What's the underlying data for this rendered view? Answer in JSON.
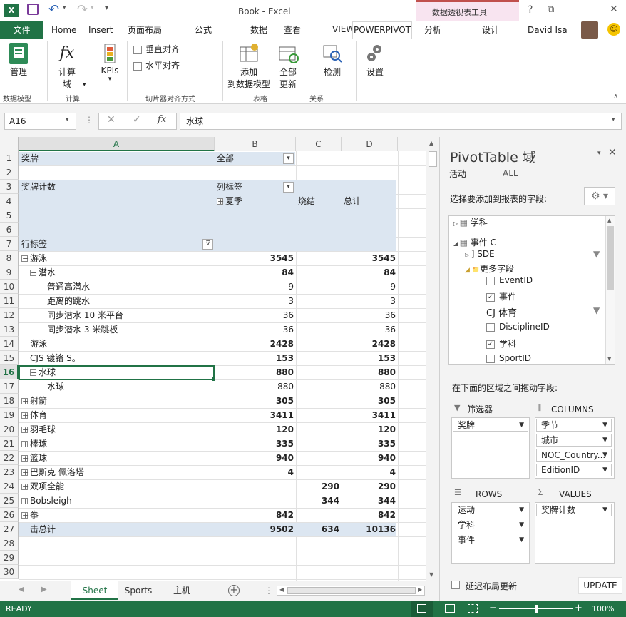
{
  "title": {
    "doc": "Book - Excel",
    "context_tools": "数据透视表工具",
    "help": "?",
    "win_restore": "⧉",
    "win_min": "—",
    "win_close": "✕"
  },
  "qat": {
    "save": "保存",
    "undo": "撤消",
    "redo": "恢复"
  },
  "tabs": {
    "file": "文件",
    "home": "Home",
    "insert": "Insert",
    "layout": "页面布局",
    "formulas": "公式",
    "data": "数据",
    "review": "查看",
    "view": "VIEW",
    "powerpivot": "POWERPIVOT",
    "analyze": "分析",
    "design": "设计",
    "user": "David Isa"
  },
  "ribbon": {
    "manage": "管理",
    "group_model": "数据模型",
    "calc": "计算",
    "calc2": "域",
    "kpis": "KPIs",
    "group_calc": "计算",
    "valign": "垂直对齐",
    "halign": "水平对齐",
    "group_slicer": "切片器对齐方式",
    "add": "添加",
    "add2": "到数据模型",
    "refresh": "全部",
    "refresh2": "更新",
    "group_table": "表格",
    "detect": "检测",
    "group_rel": "关系",
    "settings": "设置"
  },
  "formula": {
    "namebox": "A16",
    "fx": "fx",
    "value": "水球"
  },
  "columns": [
    "A",
    "B",
    "C",
    "D"
  ],
  "rows": [
    "1",
    "2",
    "3",
    "4",
    "5",
    "6",
    "7",
    "8",
    "9",
    "10",
    "11",
    "12",
    "13",
    "14",
    "15",
    "16",
    "17",
    "18",
    "19",
    "20",
    "21",
    "22",
    "23",
    "24",
    "25",
    "26",
    "27",
    "28",
    "29",
    "30"
  ],
  "pivot": {
    "r1a": "奖牌",
    "r1b": "全部",
    "r3a": "奖牌计数",
    "r3b": "列标签",
    "r4b": "夏季",
    "r4c": "烧结",
    "r4d": "总计",
    "r7a": "行标签",
    "rows": [
      {
        "label": "游泳",
        "b": "3545",
        "c": "",
        "d": "3545",
        "bold": true,
        "indent": 0,
        "pm": "−"
      },
      {
        "label": "潜水",
        "b": "84",
        "c": "",
        "d": "84",
        "bold": true,
        "indent": 1,
        "pm": "−"
      },
      {
        "label": "普通高潜水",
        "b": "9",
        "c": "",
        "d": "9",
        "bold": false,
        "indent": 3,
        "pm": ""
      },
      {
        "label": "距离的跳水",
        "b": "3",
        "c": "",
        "d": "3",
        "bold": false,
        "indent": 3,
        "pm": ""
      },
      {
        "label": "同步潜水 10 米平台",
        "b": "36",
        "c": "",
        "d": "36",
        "bold": false,
        "indent": 3,
        "pm": ""
      },
      {
        "label": "同步潜水 3 米跳板",
        "b": "36",
        "c": "",
        "d": "36",
        "bold": false,
        "indent": 3,
        "pm": ""
      },
      {
        "label": "游泳",
        "b": "2428",
        "c": "",
        "d": "2428",
        "bold": true,
        "indent": 1,
        "pm": ""
      },
      {
        "label": "CJS 镀铬 S。",
        "b": "153",
        "c": "",
        "d": "153",
        "bold": true,
        "indent": 1,
        "pm": ""
      },
      {
        "label": "水球",
        "b": "880",
        "c": "",
        "d": "880",
        "bold": true,
        "indent": 1,
        "pm": "−"
      },
      {
        "label": "水球",
        "b": "880",
        "c": "",
        "d": "880",
        "bold": false,
        "indent": 3,
        "pm": ""
      },
      {
        "label": "射箭",
        "b": "305",
        "c": "",
        "d": "305",
        "bold": true,
        "indent": 0,
        "pm": "+"
      },
      {
        "label": "体育",
        "b": "3411",
        "c": "",
        "d": "3411",
        "bold": true,
        "indent": 0,
        "pm": "+"
      },
      {
        "label": "羽毛球",
        "b": "120",
        "c": "",
        "d": "120",
        "bold": true,
        "indent": 0,
        "pm": "+"
      },
      {
        "label": "棒球",
        "b": "335",
        "c": "",
        "d": "335",
        "bold": true,
        "indent": 0,
        "pm": "+"
      },
      {
        "label": "篮球",
        "b": "940",
        "c": "",
        "d": "940",
        "bold": true,
        "indent": 0,
        "pm": "+"
      },
      {
        "label": "巴斯克 佩洛塔",
        "b": "4",
        "c": "",
        "d": "4",
        "bold": true,
        "indent": 0,
        "pm": "+"
      },
      {
        "label": "双项全能",
        "b": "",
        "c": "290",
        "d": "290",
        "bold": true,
        "indent": 0,
        "pm": "+"
      },
      {
        "label": "Bobsleigh",
        "b": "",
        "c": "344",
        "d": "344",
        "bold": true,
        "indent": 0,
        "pm": "+"
      },
      {
        "label": "拳",
        "b": "842",
        "c": "",
        "d": "842",
        "bold": true,
        "indent": 0,
        "pm": "+"
      },
      {
        "label": "击总计",
        "b": "9502",
        "c": "634",
        "d": "10136",
        "bold": true,
        "indent": 1,
        "pm": ""
      }
    ]
  },
  "sheets": {
    "s1": "Sheet",
    "s2": "Sports",
    "s3": "主机"
  },
  "pane": {
    "title": "PivotTable 域",
    "tab_active": "活动",
    "tab_all": "ALL",
    "choose": "选择要添加到报表的字段:",
    "fields": [
      {
        "text": "学科",
        "kind": "table"
      },
      {
        "text": "事件 C",
        "kind": "table"
      },
      {
        "text": "] SDE",
        "kind": "sub"
      },
      {
        "text": "更多字段",
        "kind": "folder"
      },
      {
        "text": "EventID",
        "kind": "check",
        "checked": false
      },
      {
        "text": "事件",
        "kind": "check",
        "checked": true
      },
      {
        "text": "CJ 体育",
        "kind": "plain"
      },
      {
        "text": "DisciplineID",
        "kind": "check",
        "checked": false
      },
      {
        "text": "学科",
        "kind": "check",
        "checked": true
      },
      {
        "text": "SportID",
        "kind": "check",
        "checked": false
      }
    ],
    "drag": "在下面的区域之间拖动字段:",
    "filters_label": "筛选器",
    "columns_label": "COLUMNS",
    "rows_label": "ROWS",
    "values_label": "VALUES",
    "filters": [
      "奖牌"
    ],
    "columns": [
      "季节",
      "城市",
      "NOC_Country...",
      "EditionID"
    ],
    "rows": [
      "运动",
      "学科",
      "事件"
    ],
    "values": [
      "奖牌计数"
    ],
    "defer": "延迟布局更新",
    "update": "UPDATE"
  },
  "status": {
    "ready": "READY",
    "zoom": "100%"
  },
  "colors": {
    "excel_green": "#217346",
    "pivot_header": "#dce6f1",
    "context_pink": "#f8e4f0"
  }
}
